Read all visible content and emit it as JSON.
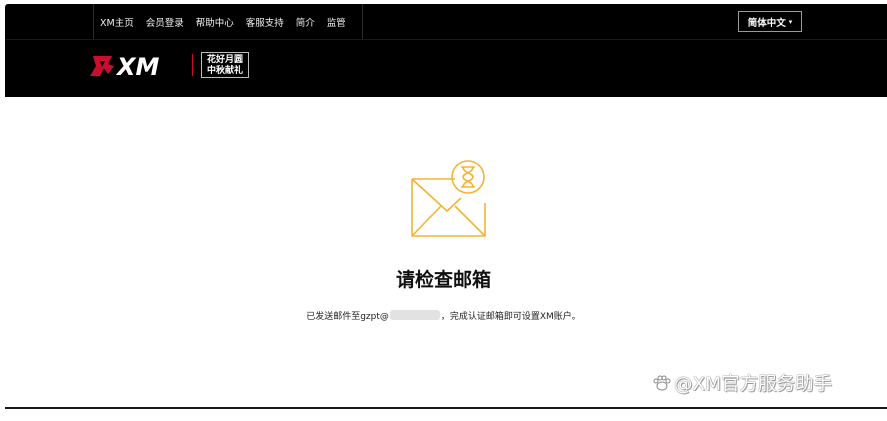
{
  "topnav": {
    "items": [
      {
        "label": "XM主页"
      },
      {
        "label": "会员登录"
      },
      {
        "label": "帮助中心"
      },
      {
        "label": "客服支持"
      },
      {
        "label": "简介"
      },
      {
        "label": "监管"
      }
    ]
  },
  "language": {
    "selected": "简体中文",
    "caret": "▾"
  },
  "brand": {
    "logo_text": "XM",
    "promo_line1": "花好月圆",
    "promo_line2": "中秋献礼"
  },
  "main": {
    "title": "请检查邮箱",
    "message_prefix": "已发送邮件至gzpt@",
    "message_suffix": "，完成认证邮箱即可设置XM账户。"
  },
  "watermark": {
    "text": "@XM官方服务助手"
  },
  "colors": {
    "accent": "#f5b335",
    "brand_red": "#c8102e",
    "bar": "#000000"
  }
}
